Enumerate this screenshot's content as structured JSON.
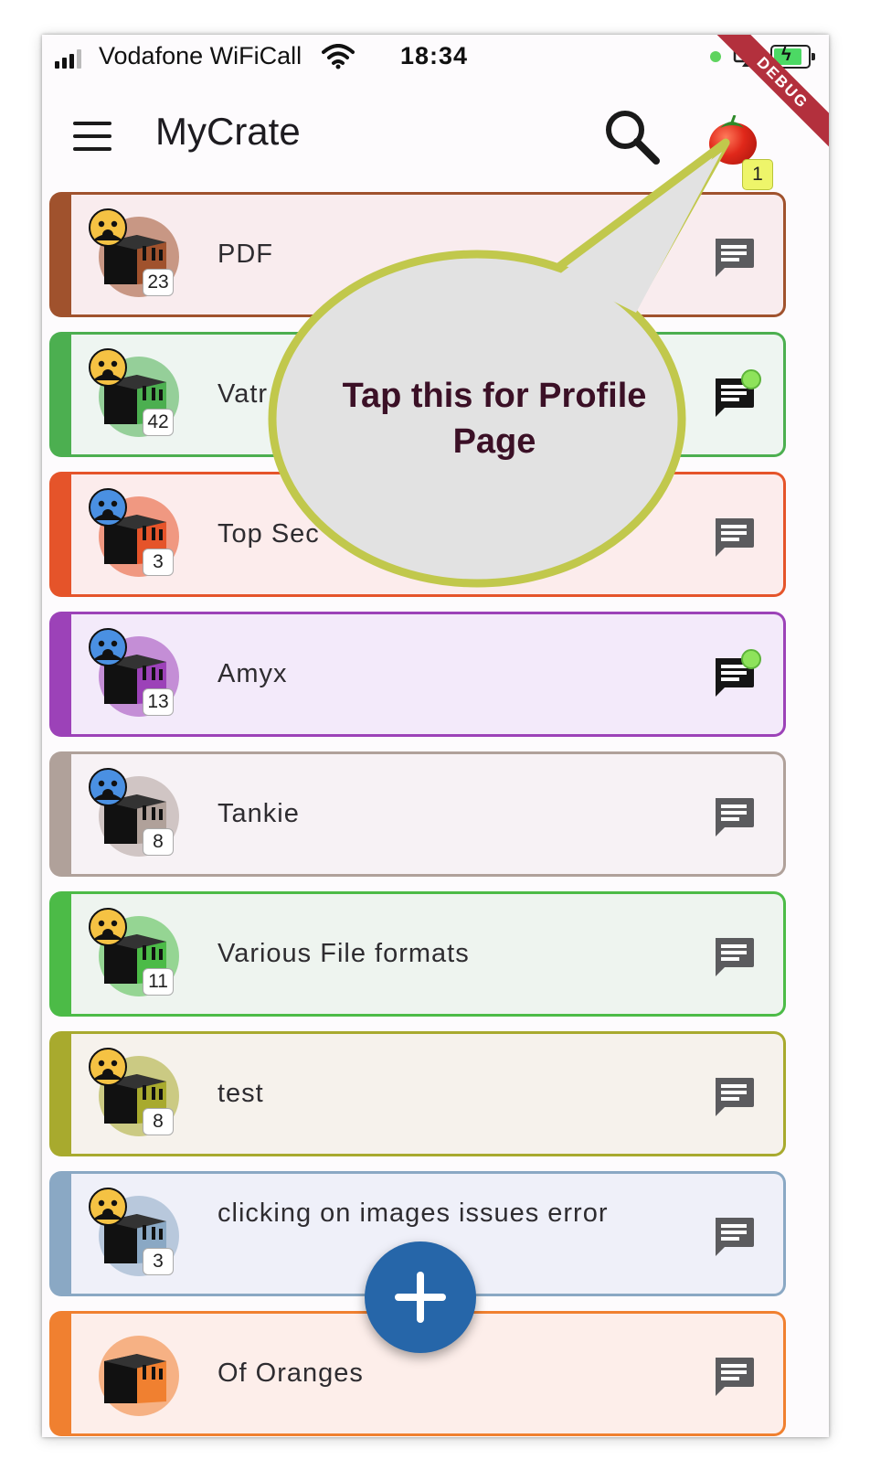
{
  "status_bar": {
    "carrier": "Vodafone WiFiCall",
    "time": "18:34",
    "debug_banner": "DEBUG"
  },
  "app_bar": {
    "title": "MyCrate",
    "menu_icon": "menu-icon",
    "search_icon": "search-icon",
    "profile_icon": "tomato-avatar-icon",
    "notification_count": "1"
  },
  "tooltip": {
    "text": "Tap this for Profile Page"
  },
  "crates": [
    {
      "name": "PDF",
      "count": "23",
      "color": "#a0522d",
      "bg": "#f9ecee",
      "face_color": "#f5c243",
      "unread": false
    },
    {
      "name": "Vatr",
      "count": "42",
      "color": "#4caf50",
      "bg": "#eef5f1",
      "face_color": "#f5c243",
      "unread": true
    },
    {
      "name": "Top Sec",
      "count": "3",
      "color": "#e5542a",
      "bg": "#fcecec",
      "face_color": "#4a90e2",
      "unread": false
    },
    {
      "name": "Amyx",
      "count": "13",
      "color": "#9c42b8",
      "bg": "#f3eafa",
      "face_color": "#4a90e2",
      "unread": true
    },
    {
      "name": "Tankie",
      "count": "8",
      "color": "#b0a19a",
      "bg": "#f7f2f5",
      "face_color": "#4a90e2",
      "unread": false
    },
    {
      "name": "Various File formats",
      "count": "11",
      "color": "#4cbb47",
      "bg": "#eef4ef",
      "face_color": "#f5c243",
      "unread": false
    },
    {
      "name": "test",
      "count": "8",
      "color": "#a8aa2e",
      "bg": "#f6f2ec",
      "face_color": "#f5c243",
      "unread": false
    },
    {
      "name": "clicking on images issues error",
      "count": "3",
      "color": "#8aa8c4",
      "bg": "#eff0f9",
      "face_color": "#f5c243",
      "unread": false
    },
    {
      "name": "Of Oranges",
      "count": "",
      "color": "#f08030",
      "bg": "#fdeeea",
      "face_color": "",
      "unread": false
    }
  ],
  "fab_icon": "add-icon"
}
